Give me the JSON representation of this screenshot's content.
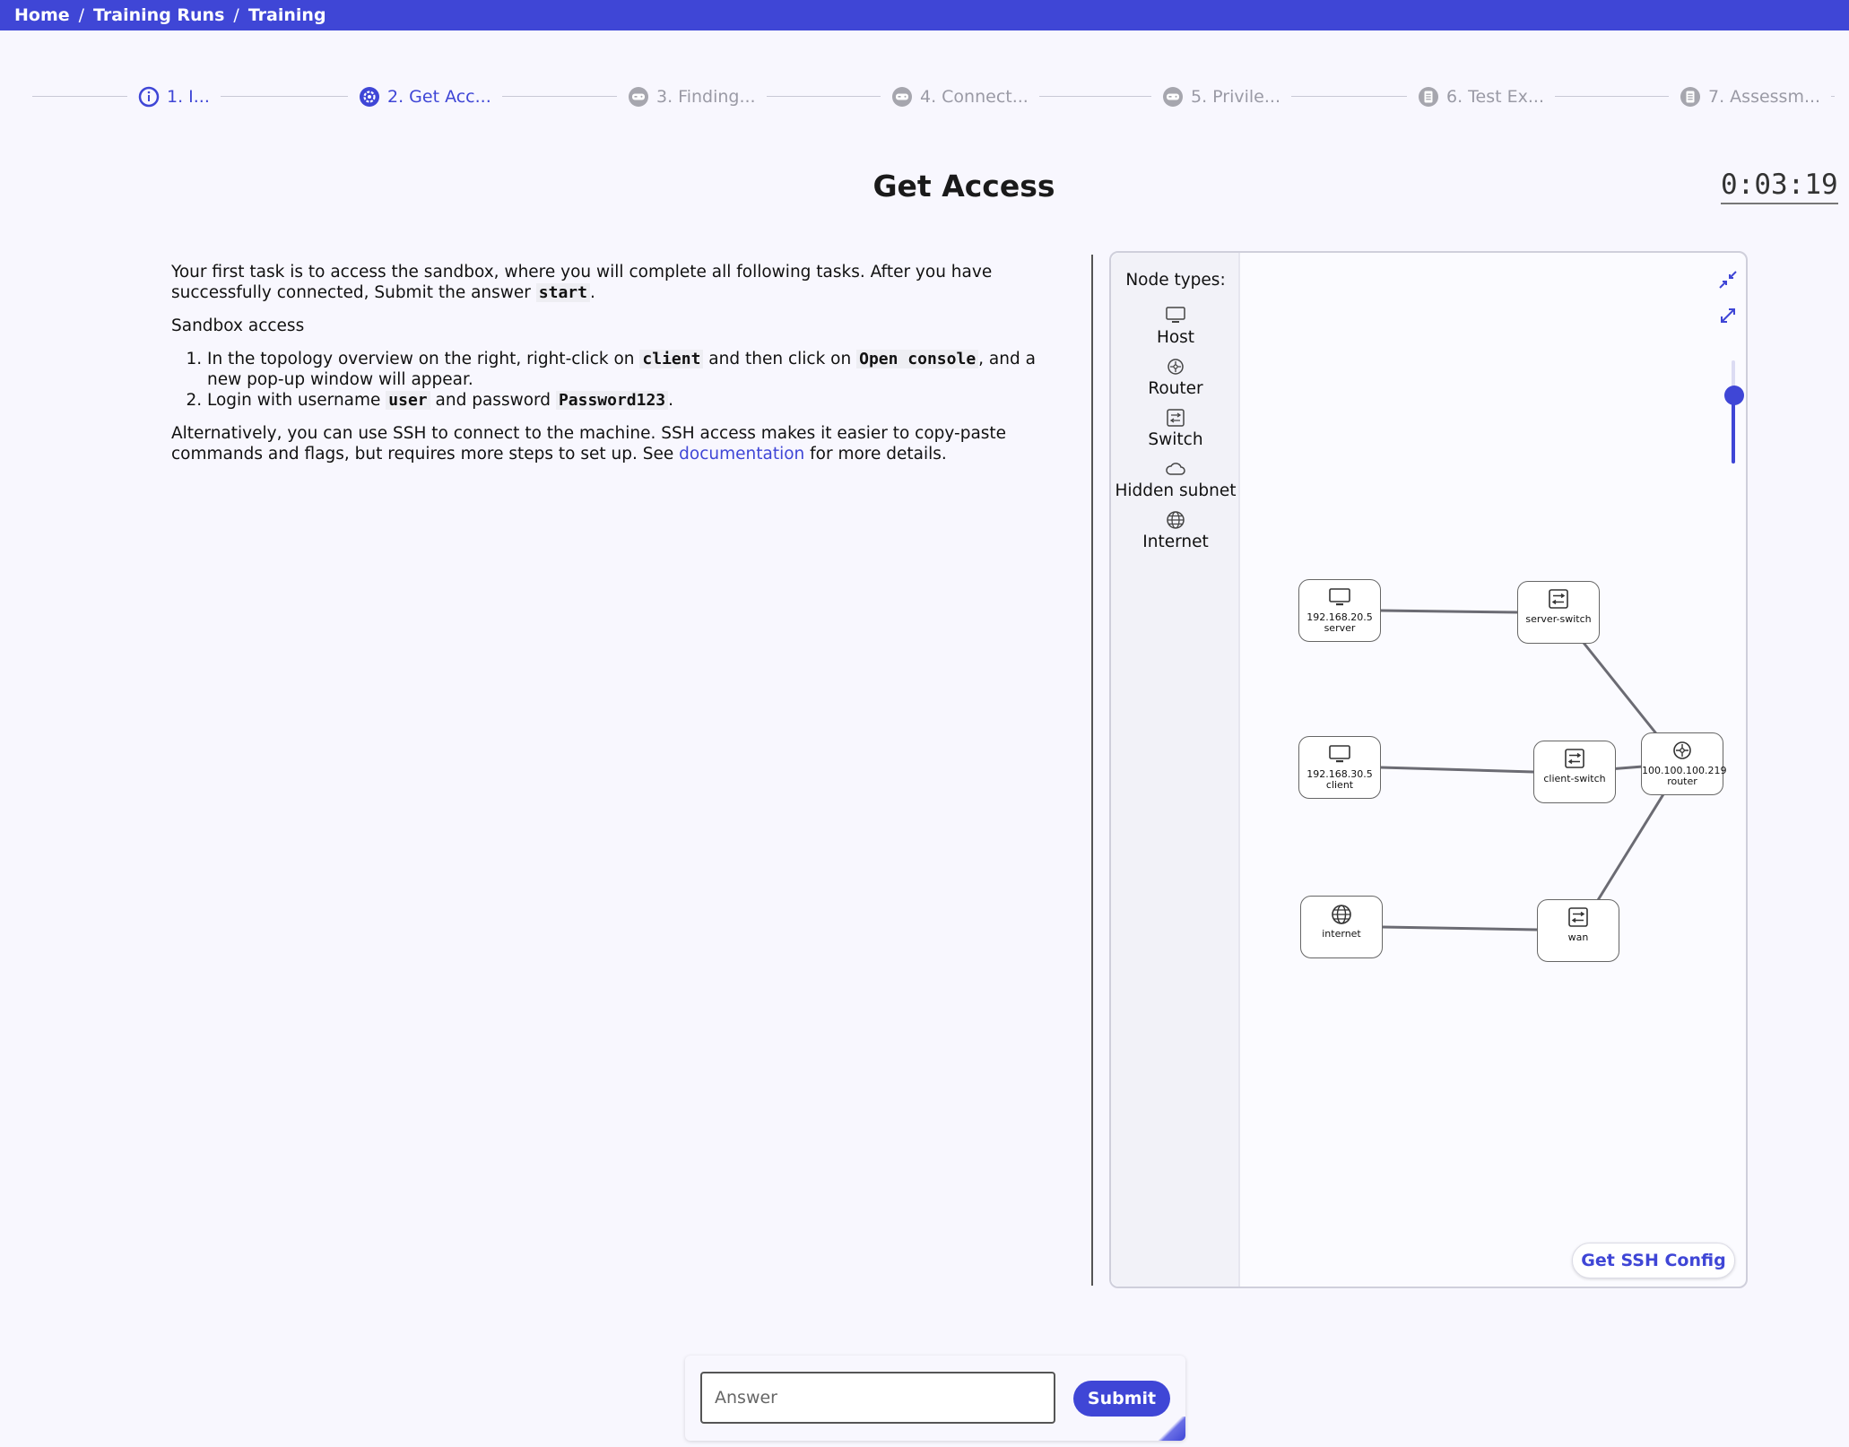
{
  "breadcrumb": {
    "items": [
      "Home",
      "Training Runs",
      "Training"
    ],
    "separator": "/"
  },
  "stepper": {
    "steps": [
      {
        "label": "1. I...",
        "icon": "info-icon",
        "state": "active"
      },
      {
        "label": "2. Get Acc...",
        "icon": "gear-icon",
        "state": "active"
      },
      {
        "label": "3. Finding...",
        "icon": "gamepad-icon",
        "state": "inactive"
      },
      {
        "label": "4. Connect...",
        "icon": "gamepad-icon",
        "state": "inactive"
      },
      {
        "label": "5. Privile...",
        "icon": "gamepad-icon",
        "state": "inactive"
      },
      {
        "label": "6. Test Ex...",
        "icon": "document-icon",
        "state": "inactive"
      },
      {
        "label": "7. Assessm...",
        "icon": "document-icon",
        "state": "inactive"
      }
    ]
  },
  "page": {
    "title": "Get Access",
    "timer": "0:03:19"
  },
  "instructions": {
    "intro_1": "Your first task is to access the sandbox, where you will complete all following tasks. After you have successfully connected, Submit the answer ",
    "intro_code": "start",
    "intro_2": ".",
    "section_heading": "Sandbox access",
    "step1_a": "In the topology overview on the right, right-click on ",
    "step1_code1": "client",
    "step1_b": " and then click on ",
    "step1_code2": "Open console",
    "step1_c": ", and a new pop-up window will appear.",
    "step2_a": "Login with username ",
    "step2_code1": "user",
    "step2_b": " and password ",
    "step2_code2": "Password123",
    "step2_c": ".",
    "alt_a": "Alternatively, you can use SSH to connect to the machine. SSH access makes it easier to copy-paste commands and flags, but requires more steps to set up. See ",
    "alt_link": "documentation",
    "alt_b": " for more details."
  },
  "topology": {
    "legend_title": "Node types:",
    "legend": [
      {
        "label": "Host",
        "icon": "monitor-icon"
      },
      {
        "label": "Router",
        "icon": "router-icon"
      },
      {
        "label": "Switch",
        "icon": "switch-icon"
      },
      {
        "label": "Hidden subnet",
        "icon": "cloud-icon"
      },
      {
        "label": "Internet",
        "icon": "globe-icon"
      }
    ],
    "nodes": [
      {
        "id": "server",
        "icon": "monitor-icon",
        "line1": "192.168.20.5",
        "line2": "server"
      },
      {
        "id": "server-switch",
        "icon": "switch-icon",
        "line1": "server-switch",
        "line2": ""
      },
      {
        "id": "client",
        "icon": "monitor-icon",
        "line1": "192.168.30.5",
        "line2": "client"
      },
      {
        "id": "client-switch",
        "icon": "switch-icon",
        "line1": "client-switch",
        "line2": ""
      },
      {
        "id": "router",
        "icon": "router-icon",
        "line1": "100.100.100.219",
        "line2": "router"
      },
      {
        "id": "internet",
        "icon": "globe-icon",
        "line1": "internet",
        "line2": ""
      },
      {
        "id": "wan",
        "icon": "switch-icon",
        "line1": "wan",
        "line2": ""
      }
    ],
    "ssh_button": "Get SSH Config",
    "accent": "#3f46d6"
  },
  "answer": {
    "placeholder": "Answer",
    "value": "",
    "submit_label": "Submit"
  }
}
